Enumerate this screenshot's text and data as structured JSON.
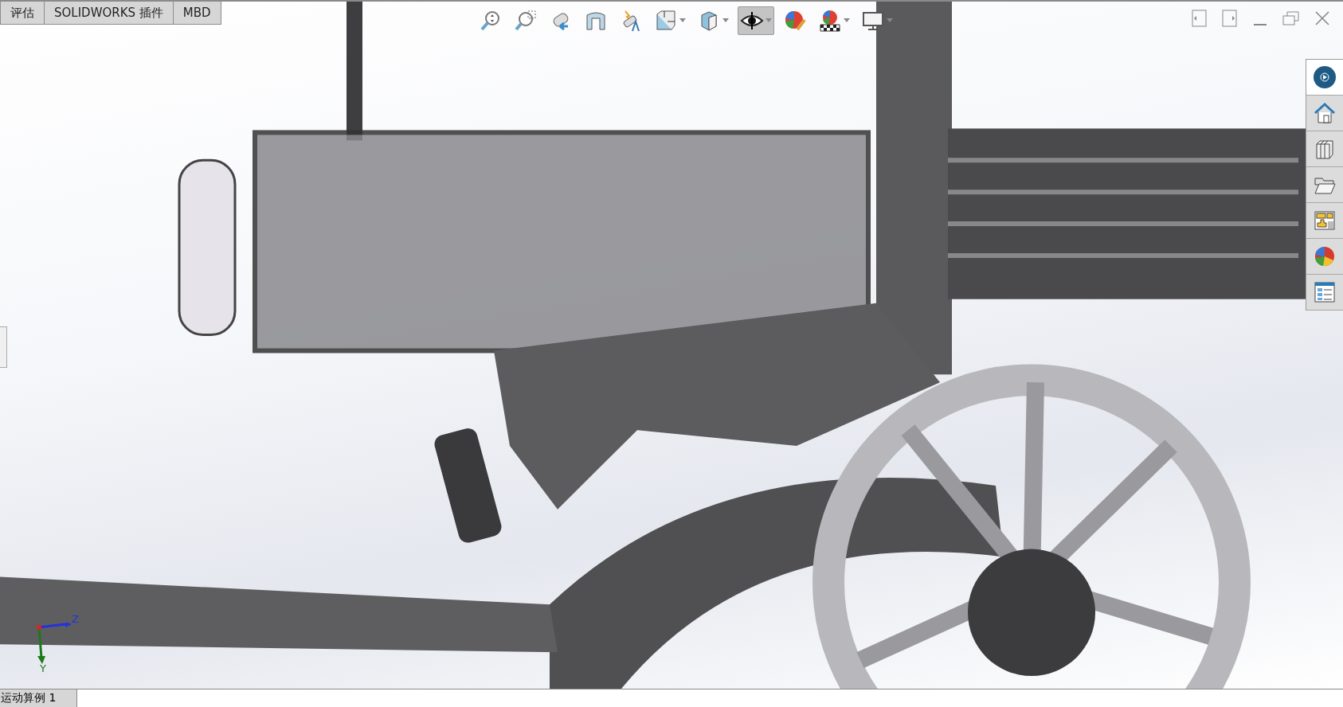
{
  "tabs": [
    {
      "label": "评估",
      "selected": false
    },
    {
      "label": "SOLIDWORKS 插件",
      "selected": false
    },
    {
      "label": "MBD",
      "selected": false
    }
  ],
  "view_toolbar": [
    {
      "kind": "zoom-fit",
      "pressed": false,
      "dropdown": false
    },
    {
      "kind": "zoom-area",
      "pressed": false,
      "dropdown": false
    },
    {
      "kind": "previous-view",
      "pressed": false,
      "dropdown": false
    },
    {
      "kind": "section",
      "pressed": false,
      "dropdown": false
    },
    {
      "kind": "dynamic-annotation",
      "pressed": false,
      "dropdown": false
    },
    {
      "kind": "view-orientation",
      "pressed": false,
      "dropdown": true
    },
    {
      "kind": "display-style",
      "pressed": false,
      "dropdown": true
    },
    {
      "kind": "hide-show",
      "pressed": true,
      "dropdown": true
    },
    {
      "kind": "edit-appearance",
      "pressed": false,
      "dropdown": false
    },
    {
      "kind": "scene",
      "pressed": false,
      "dropdown": true
    },
    {
      "kind": "view-settings",
      "pressed": false,
      "dropdown": true
    }
  ],
  "task_pane": [
    {
      "kind": "resources",
      "selected": true
    },
    {
      "kind": "home",
      "selected": false
    },
    {
      "kind": "library",
      "selected": false
    },
    {
      "kind": "explorer",
      "selected": false
    },
    {
      "kind": "palette",
      "selected": false
    },
    {
      "kind": "appearance",
      "selected": false
    },
    {
      "kind": "properties",
      "selected": false
    }
  ],
  "triad": {
    "z_label": "Z",
    "y_label": "Y"
  },
  "status_bar": {
    "study_tab": "运动算例 1"
  }
}
